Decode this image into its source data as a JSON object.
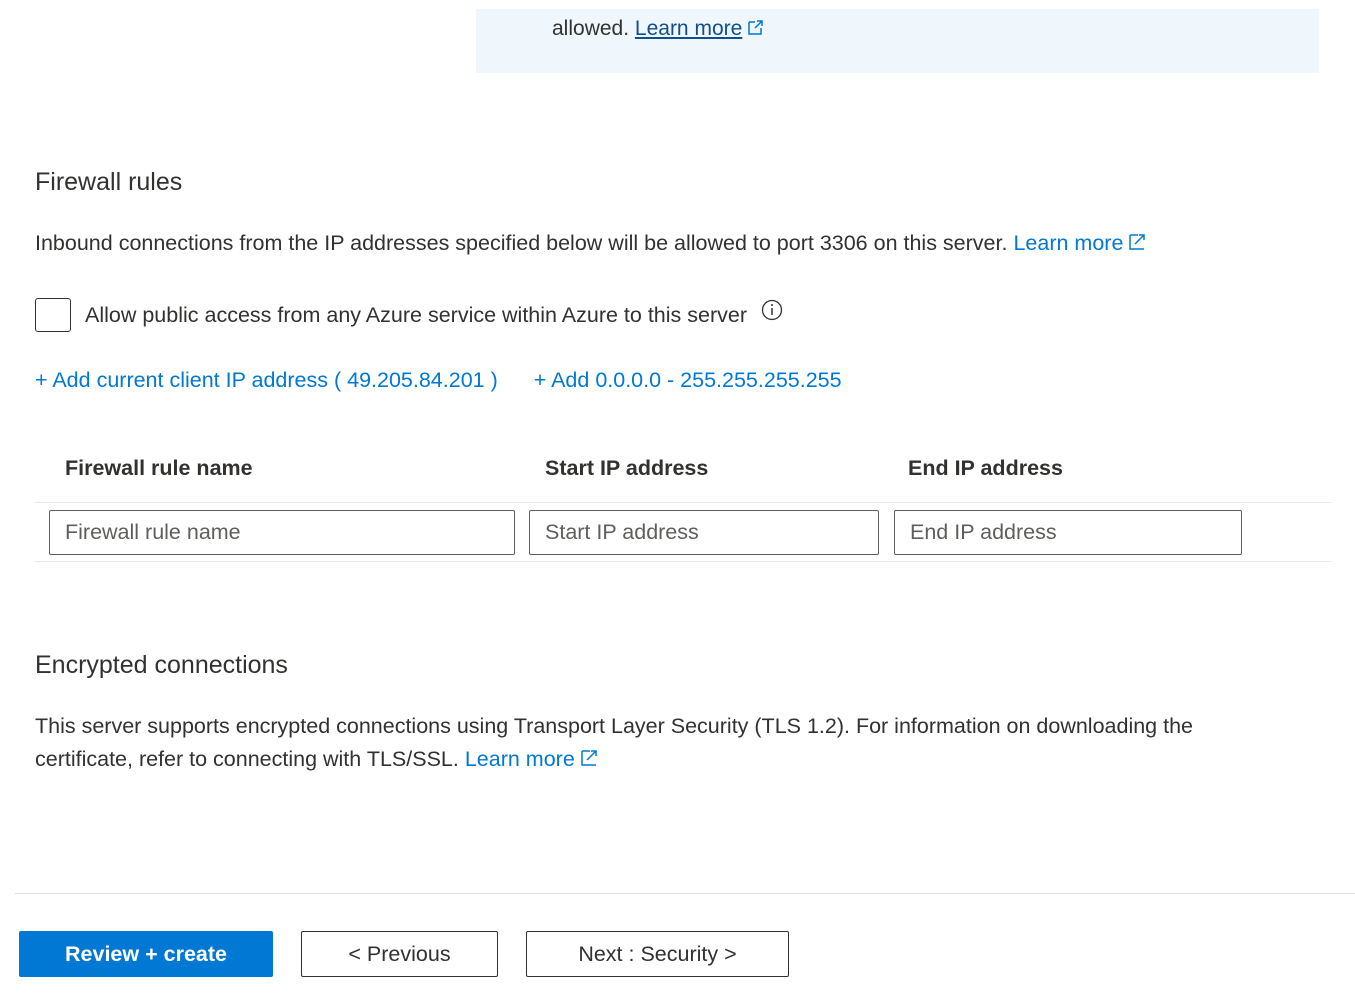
{
  "info_box": {
    "text": "allowed.",
    "link": "Learn more"
  },
  "firewall": {
    "title": "Firewall rules",
    "description": "Inbound connections from the IP addresses specified below will be allowed to port 3306 on this server.",
    "learn_more": "Learn more",
    "checkbox_label": "Allow public access from any Azure service within Azure to this server",
    "checkbox_checked": false,
    "add_client_ip": "+ Add current client IP address ( 49.205.84.201 )",
    "add_range": "+ Add 0.0.0.0 - 255.255.255.255",
    "table": {
      "columns": [
        "Firewall rule name",
        "Start IP address",
        "End IP address"
      ],
      "placeholders": [
        "Firewall rule name",
        "Start IP address",
        "End IP address"
      ]
    }
  },
  "encryption": {
    "title": "Encrypted connections",
    "description_line1": "This server supports encrypted connections using Transport Layer Security (TLS 1.2). For information on downloading the",
    "description_line2": "certificate, refer to connecting with TLS/SSL.",
    "learn_more": "Learn more"
  },
  "footer": {
    "review_create": "Review + create",
    "previous": "< Previous",
    "next": "Next : Security >"
  },
  "colors": {
    "accent": "#0078d4",
    "info_bg": "#eff6fc"
  }
}
